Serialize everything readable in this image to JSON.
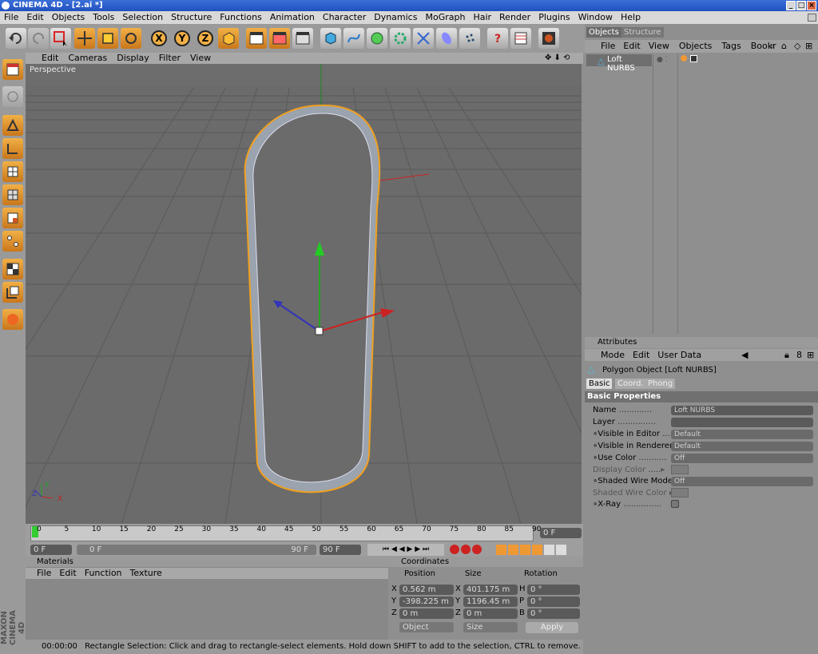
{
  "window": {
    "title": "CINEMA 4D - [2.ai *]"
  },
  "menu": [
    "File",
    "Edit",
    "Objects",
    "Tools",
    "Selection",
    "Structure",
    "Functions",
    "Animation",
    "Character",
    "Dynamics",
    "MoGraph",
    "Hair",
    "Render",
    "Plugins",
    "Window",
    "Help"
  ],
  "toolbar": {
    "tools": [
      "undo-icon",
      "redo-icon",
      "rectangle-selection-icon",
      "move-icon",
      "scale-icon",
      "rotate-icon",
      "x-axis-icon",
      "y-axis-icon",
      "z-axis-icon",
      "coordinate-system-icon",
      "render-view-icon",
      "render-picture-viewer-icon",
      "edit-render-settings-icon",
      "cube-primitive-icon",
      "spline-icon",
      "nurbs-icon",
      "array-icon",
      "deformer-icon",
      "scene-icon",
      "light-icon",
      "help-icon",
      "timeline-icon",
      "layout-icon"
    ],
    "axis_x": "X",
    "axis_y": "Y",
    "axis_z": "Z"
  },
  "left_tools": [
    "use-model-icon",
    "use-object-axis-icon",
    "points-mode-icon",
    "edges-mode-icon",
    "polygons-mode-icon",
    "texture-icon",
    "workplane-icon",
    "snap-icon",
    "soft-selection-icon",
    "uv-icon",
    "paint-icon"
  ],
  "viewport": {
    "menu": [
      "Edit",
      "Cameras",
      "Display",
      "Filter",
      "View"
    ],
    "label": "Perspective",
    "axis_labels": {
      "x": "X",
      "y": "Y",
      "z": "Z"
    }
  },
  "timeline": {
    "ticks": [
      "0",
      "5",
      "10",
      "15",
      "20",
      "25",
      "30",
      "35",
      "40",
      "45",
      "50",
      "55",
      "60",
      "65",
      "70",
      "75",
      "80",
      "85",
      "90"
    ],
    "current_frame": "0 F",
    "start": "0 F",
    "slider_start": "0 F",
    "slider_end": "90 F",
    "end": "90 F"
  },
  "materials": {
    "title": "Materials",
    "menu": [
      "File",
      "Edit",
      "Function",
      "Texture"
    ]
  },
  "coordinates": {
    "title": "Coordinates",
    "headers": [
      "Position",
      "Size",
      "Rotation"
    ],
    "rows": [
      {
        "axis": "X",
        "pos": "0.562 m",
        "saxis": "X",
        "size": "401.175 m",
        "raxis": "H",
        "rot": "0 °"
      },
      {
        "axis": "Y",
        "pos": "-398.225 m",
        "saxis": "Y",
        "size": "1196.45 m",
        "raxis": "P",
        "rot": "0 °"
      },
      {
        "axis": "Z",
        "pos": "0 m",
        "saxis": "Z",
        "size": "0 m",
        "raxis": "B",
        "rot": "0 °"
      }
    ],
    "mode_object": "Object",
    "mode_size": "Size",
    "apply": "Apply"
  },
  "status": {
    "time": "00:00:00",
    "message": "Rectangle Selection: Click and drag to rectangle-select elements. Hold down SHIFT to add to the selection, CTRL to remove."
  },
  "brand": "MAXON CINEMA 4D",
  "objects_panel": {
    "tabs": [
      "Objects",
      "Structure"
    ],
    "menu": [
      "File",
      "Edit",
      "View",
      "Objects",
      "Tags",
      "Bookr"
    ],
    "items": [
      {
        "name": "Loft NURBS"
      }
    ]
  },
  "attributes": {
    "title": "Attributes",
    "menu": [
      "Mode",
      "Edit",
      "User Data"
    ],
    "object_title": "Polygon Object [Loft NURBS]",
    "tabs": [
      "Basic",
      "Coord.",
      "Phong"
    ],
    "section": "Basic Properties",
    "props": [
      {
        "label": "Name",
        "value": "Loft NURBS"
      },
      {
        "label": "Layer",
        "value": ""
      },
      {
        "label": "Visible in Editor",
        "value": "Default"
      },
      {
        "label": "Visible in Renderer",
        "value": "Default"
      },
      {
        "label": "Use Color",
        "value": "Off"
      },
      {
        "label": "Display Color",
        "value": ""
      },
      {
        "label": "Shaded Wire Mode",
        "value": "Off"
      },
      {
        "label": "Shaded Wire Color",
        "value": ""
      },
      {
        "label": "X-Ray",
        "value": ""
      }
    ]
  }
}
